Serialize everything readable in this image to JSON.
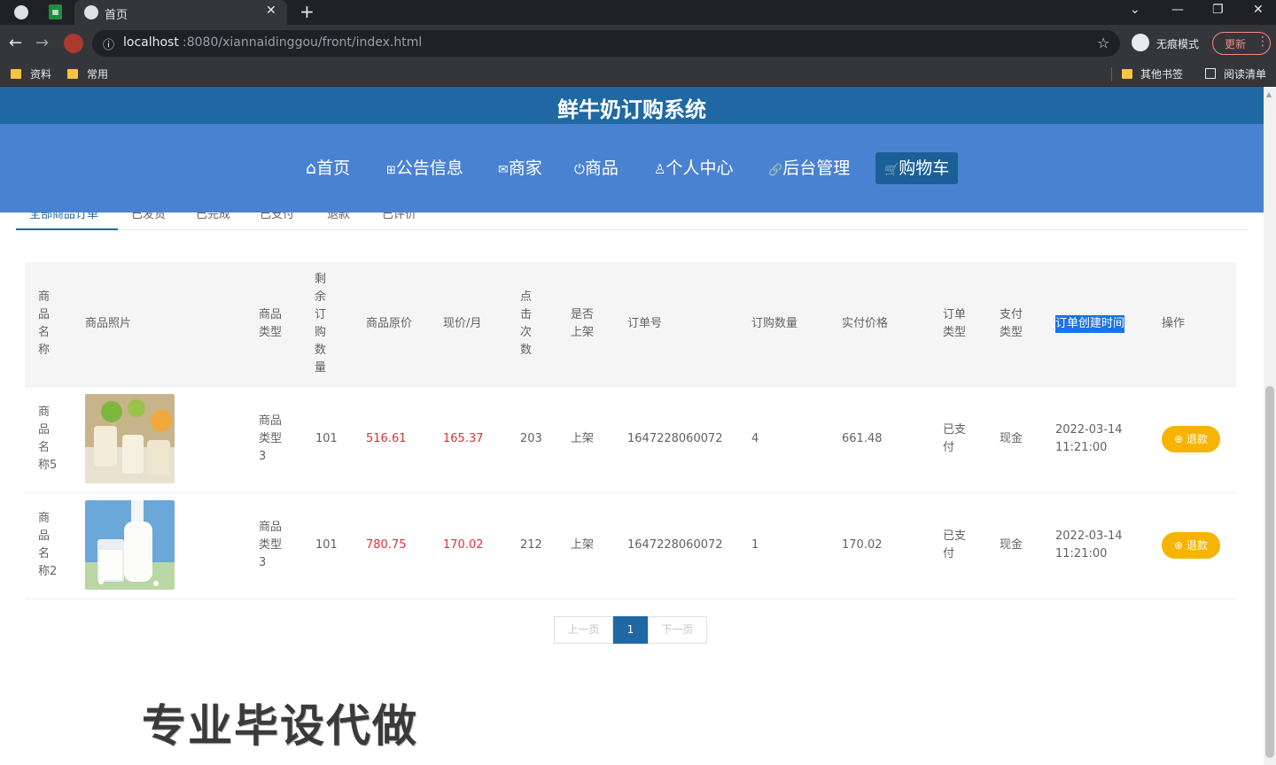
{
  "browser": {
    "tab_title": "首页",
    "tab_close": "✕",
    "new_tab": "+",
    "url_info": "ⓘ",
    "url_host": "localhost",
    "url_rest": ":8080/xiannaidinggou/front/index.html",
    "incognito_label": "无痕模式",
    "update_label": "更新",
    "bookmarks": [
      "资料",
      "常用",
      "其他书签",
      "阅读清单"
    ]
  },
  "site": {
    "title": "鲜牛奶订购系统",
    "nav": [
      {
        "icon": "home-icon",
        "glyph": "⌂",
        "label": "首页"
      },
      {
        "icon": "gift-icon",
        "glyph": "⊞",
        "label": "公告信息"
      },
      {
        "icon": "mail-icon",
        "glyph": "✉",
        "label": "商家"
      },
      {
        "icon": "power-icon",
        "glyph": "⏻",
        "label": "商品"
      },
      {
        "icon": "user-icon",
        "glyph": "♙",
        "label": "个人中心"
      },
      {
        "icon": "link-icon",
        "glyph": "🔗",
        "label": "后台管理"
      },
      {
        "icon": "cart-icon",
        "glyph": "🛒",
        "label": "购物车"
      }
    ]
  },
  "subtabs": [
    "全部商品订单",
    "已发货",
    "已完成",
    "已支付",
    "退款",
    "已评价"
  ],
  "table": {
    "headers": {
      "name": "商品名称",
      "photo": "商品照片",
      "type": "商品类型",
      "stock": "剩余订购数量",
      "orig_price": "商品原价",
      "cur_price": "现价/月",
      "clicks": "点击次数",
      "on_shelf": "是否上架",
      "order_no": "订单号",
      "qty": "订购数量",
      "paid": "实付价格",
      "order_type": "订单类型",
      "pay_type": "支付类型",
      "created": "订单创建时间",
      "ops": "操作"
    },
    "rows": [
      {
        "name": "商品名称5",
        "type": "商品类型3",
        "stock": "101",
        "orig_price": "516.61",
        "cur_price": "165.37",
        "clicks": "203",
        "on_shelf": "上架",
        "order_no": "1647228060072",
        "qty": "4",
        "paid": "661.48",
        "order_type": "已支付",
        "pay_type": "现金",
        "created_date": "2022-03-14",
        "created_time": "11:21:00",
        "action": "退款"
      },
      {
        "name": "商品名称2",
        "type": "商品类型3",
        "stock": "101",
        "orig_price": "780.75",
        "cur_price": "170.02",
        "clicks": "212",
        "on_shelf": "上架",
        "order_no": "1647228060072",
        "qty": "1",
        "paid": "170.02",
        "order_type": "已支付",
        "pay_type": "现金",
        "created_date": "2022-03-14",
        "created_time": "11:21:00",
        "action": "退款"
      }
    ]
  },
  "pager": {
    "prev": "上一页",
    "page": "1",
    "next": "下一页"
  },
  "watermark": "专业毕设代做",
  "colors": {
    "header_dark": "#1f68a4",
    "nav_blue": "#4a82d2",
    "price_red": "#e0303a",
    "refund_yellow": "#f6b300"
  }
}
